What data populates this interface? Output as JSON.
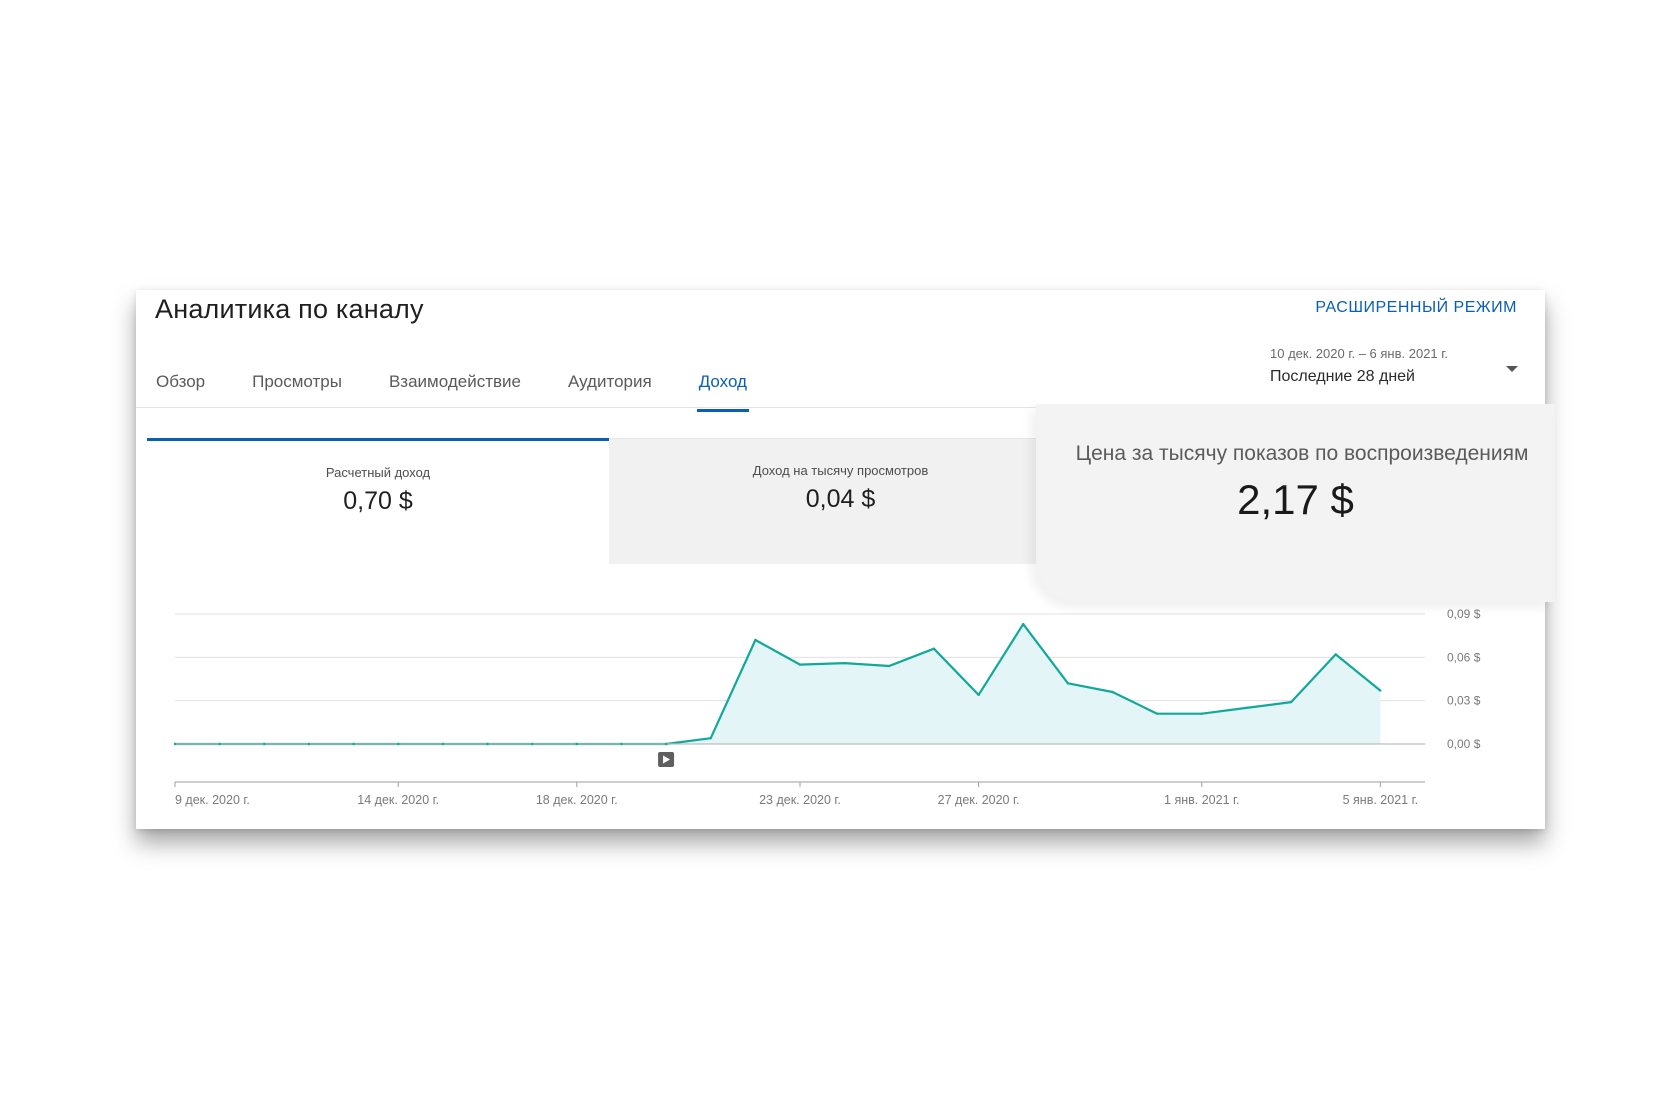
{
  "header": {
    "title": "Аналитика по каналу",
    "advanced_mode_label": "РАСШИРЕННЫЙ РЕЖИМ"
  },
  "tabs": [
    {
      "label": "Обзор",
      "active": false
    },
    {
      "label": "Просмотры",
      "active": false
    },
    {
      "label": "Взаимодействие",
      "active": false
    },
    {
      "label": "Аудитория",
      "active": false
    },
    {
      "label": "Доход",
      "active": true
    }
  ],
  "date_picker": {
    "range": "10 дек. 2020 г. – 6 янв. 2021 г.",
    "preset": "Последние 28 дней",
    "icon": "chevron-down-icon"
  },
  "metrics": [
    {
      "label": "Расчетный доход",
      "value": "0,70 $",
      "selected": true
    },
    {
      "label": "Доход на тысячу просмотров",
      "value": "0,04 $",
      "selected": false
    },
    {
      "label": "Цена за тысячу показов по воспроизведениям",
      "value": "2,17 $",
      "selected": false
    }
  ],
  "chart_data": {
    "type": "area",
    "x": [
      "2020-12-09",
      "2020-12-10",
      "2020-12-11",
      "2020-12-12",
      "2020-12-13",
      "2020-12-14",
      "2020-12-15",
      "2020-12-16",
      "2020-12-17",
      "2020-12-18",
      "2020-12-19",
      "2020-12-20",
      "2020-12-21",
      "2020-12-22",
      "2020-12-23",
      "2020-12-24",
      "2020-12-25",
      "2020-12-26",
      "2020-12-27",
      "2020-12-28",
      "2020-12-29",
      "2020-12-30",
      "2020-12-31",
      "2021-01-01",
      "2021-01-02",
      "2021-01-03",
      "2021-01-04",
      "2021-01-05",
      "2021-01-06"
    ],
    "values": [
      0,
      0,
      0,
      0,
      0,
      0,
      0,
      0,
      0,
      0,
      0,
      0,
      0.004,
      0.072,
      0.055,
      0.056,
      0.054,
      0.066,
      0.034,
      0.083,
      0.042,
      0.036,
      0.021,
      0.021,
      0.025,
      0.029,
      0.062,
      0.037,
      null
    ],
    "ylim": [
      0,
      0.09
    ],
    "y_ticks": [
      "0,00 $",
      "0,03 $",
      "0,06 $",
      "0,09 $"
    ],
    "y_tick_values": [
      0,
      0.03,
      0.06,
      0.09
    ],
    "x_tick_labels": [
      {
        "date": "2020-12-09",
        "label": "9 дек. 2020 г."
      },
      {
        "date": "2020-12-14",
        "label": "14 дек. 2020 г."
      },
      {
        "date": "2020-12-18",
        "label": "18 дек. 2020 г."
      },
      {
        "date": "2020-12-23",
        "label": "23 дек. 2020 г."
      },
      {
        "date": "2020-12-27",
        "label": "27 дек. 2020 г."
      },
      {
        "date": "2021-01-01",
        "label": "1 янв. 2021 г."
      },
      {
        "date": "2021-01-05",
        "label": "5 янв. 2021 г."
      }
    ],
    "grid": true,
    "y_axis_side": "right",
    "line_color": "#12a89a",
    "fill_color": "#e4f5f8",
    "marker": {
      "date": "2020-12-20",
      "icon": "play-icon"
    }
  }
}
